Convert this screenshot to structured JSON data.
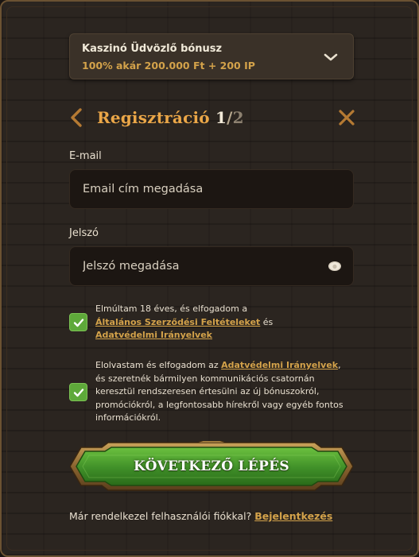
{
  "bonus": {
    "title": "Kaszinó Üdvözlő bónusz",
    "subtitle": "100% akár 200.000 Ft + 200 IP"
  },
  "header": {
    "title": "Regisztráció",
    "step_current": "1",
    "step_separator": "/",
    "step_total": "2"
  },
  "email": {
    "label": "E-mail",
    "placeholder": "Email cím megadása",
    "value": ""
  },
  "password": {
    "label": "Jelszó",
    "placeholder": "Jelszó megadása",
    "value": ""
  },
  "consent_age": {
    "checked": true,
    "text_before": "Elmúltam 18 éves, és elfogadom a",
    "terms_link": "Általános Szerződési Feltételeket",
    "text_and": "és",
    "privacy_link": "Adatvédelmi Irányelvek"
  },
  "consent_marketing": {
    "checked": true,
    "text_before": "Elolvastam és elfogadom az",
    "privacy_link": "Adatvédelmi Irányelvek",
    "text_after": ", és szeretnék bármilyen kommunikációs csatornán keresztül rendszeresen értesülni az új bónuszokról, promóciókról, a legfontosabb hírekről vagy egyéb fontos információkról."
  },
  "next_button": {
    "label": "KÖVETKEZŐ LÉPÉS"
  },
  "footer": {
    "text": "Már rendelkezel felhasználói fiókkal?",
    "login_link": "Bejelentkezés"
  },
  "colors": {
    "accent": "#eba748",
    "link": "#d3a24a",
    "checkbox": "#5ea93a",
    "button_green": "#3f8f28",
    "button_frame": "#a07a3c"
  },
  "icons": {
    "bonus_toggle": "chevron-down-icon",
    "back": "chevron-left-icon",
    "close": "close-icon",
    "password_toggle": "eye-icon",
    "checkbox": "check-icon"
  }
}
